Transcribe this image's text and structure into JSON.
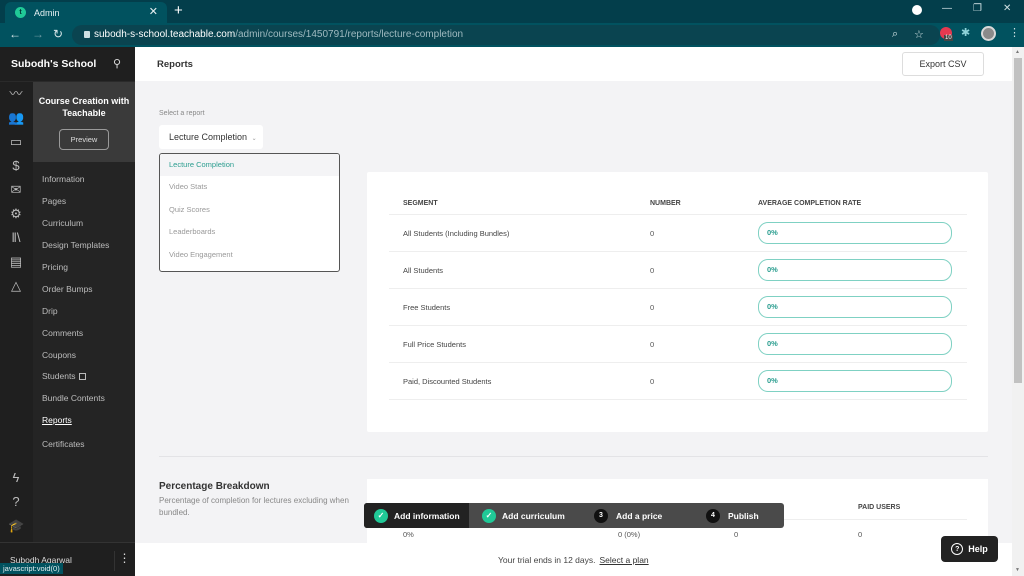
{
  "browser": {
    "tab_title": "Admin",
    "tab_favicon_letter": "t",
    "url_host": "subodh-s-school.teachable.com",
    "url_path": "/admin/courses/1450791/reports/lecture-completion",
    "extension_badge": "10",
    "status_url": "javascript:void(0)"
  },
  "sidebar": {
    "school_name": "Subodh's School",
    "rail_icons": [
      "analytics-icon",
      "users-icon",
      "devices-icon",
      "dollar-icon",
      "mail-icon",
      "settings-icon",
      "library-icon",
      "calendar-icon",
      "shapes-icon"
    ],
    "rail_bottom_icons": [
      "lightning-icon",
      "help-circle-icon",
      "graduation-cap-icon"
    ],
    "course_title": "Course Creation with Teachable",
    "preview_label": "Preview",
    "items": [
      {
        "label": "Information"
      },
      {
        "label": "Pages"
      },
      {
        "label": "Curriculum"
      },
      {
        "label": "Design Templates"
      },
      {
        "label": "Pricing"
      },
      {
        "label": "Order Bumps"
      },
      {
        "label": "Drip"
      },
      {
        "label": "Comments"
      },
      {
        "label": "Coupons"
      },
      {
        "label": "Students"
      },
      {
        "label": "Bundle Contents"
      },
      {
        "label": "Reports"
      },
      {
        "label": "Certificates"
      }
    ],
    "active_item": "Reports",
    "user_name": "Subodh Agarwal"
  },
  "header": {
    "title": "Reports",
    "export_label": "Export CSV"
  },
  "report_select": {
    "label": "Select a report",
    "selected": "Lecture Completion",
    "options": [
      "Lecture Completion",
      "Video Stats",
      "Quiz Scores",
      "Leaderboards",
      "Video Engagement"
    ]
  },
  "completion_table": {
    "headers": [
      "SEGMENT",
      "NUMBER",
      "AVERAGE COMPLETION RATE"
    ],
    "rows": [
      {
        "segment": "All Students (Including Bundles)",
        "number": "0",
        "rate": "0%",
        "rate_value": 0
      },
      {
        "segment": "All Students",
        "number": "0",
        "rate": "0%",
        "rate_value": 0
      },
      {
        "segment": "Free Students",
        "number": "0",
        "rate": "0%",
        "rate_value": 0
      },
      {
        "segment": "Full Price Students",
        "number": "0",
        "rate": "0%",
        "rate_value": 0
      },
      {
        "segment": "Paid, Discounted Students",
        "number": "0",
        "rate": "0%",
        "rate_value": 0
      }
    ]
  },
  "percentage_breakdown": {
    "title": "Percentage Breakdown",
    "description": "Percentage of completion for lectures excluding when bundled.",
    "visible_header": "PAID USERS",
    "row": [
      "0%",
      "0 (0%)",
      "0",
      "0"
    ]
  },
  "setup_steps": [
    {
      "label": "Add information",
      "done": true,
      "num": "1"
    },
    {
      "label": "Add curriculum",
      "done": true,
      "num": "2"
    },
    {
      "label": "Add a price",
      "done": false,
      "num": "3"
    },
    {
      "label": "Publish",
      "done": false,
      "num": "4"
    }
  ],
  "trial": {
    "text": "Your trial ends in 12 days.",
    "link": "Select a plan"
  },
  "help_label": "Help"
}
